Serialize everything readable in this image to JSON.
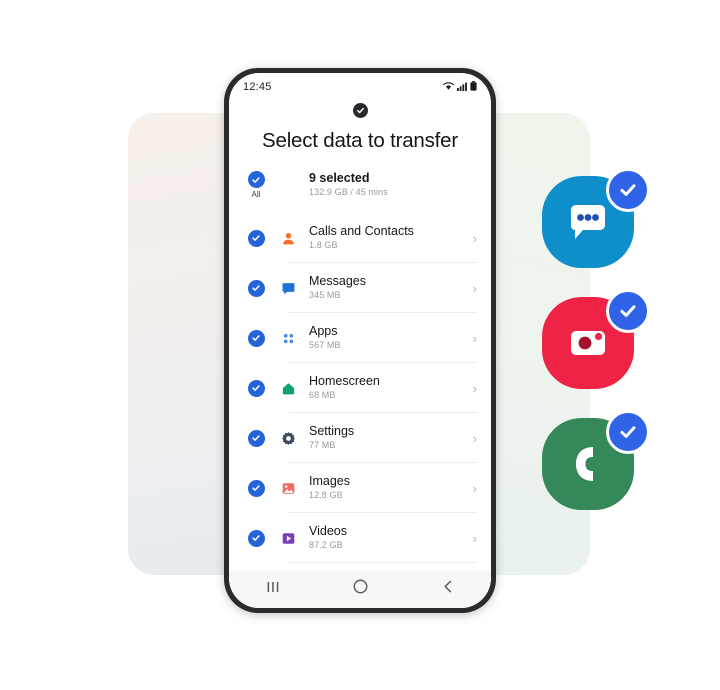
{
  "background": {
    "panel_left_color": "#f3eeec",
    "panel_right_color": "#eef4ee"
  },
  "phone": {
    "status_bar": {
      "time": "12:45",
      "icons": [
        "wifi-icon",
        "signal-icon",
        "battery-icon"
      ]
    },
    "camera_badge_icon": "check-circle-icon",
    "title": "Select data to transfer",
    "summary": {
      "checkbox_label": "All",
      "title": "9 selected",
      "subtitle": "132.9 GB / 45 mins",
      "checked": true
    },
    "items": [
      {
        "icon": "contacts-icon",
        "icon_color": "#f2722b",
        "title": "Calls and Contacts",
        "size": "1.8 GB",
        "checked": true,
        "chevron": "›"
      },
      {
        "icon": "messages-icon",
        "icon_color": "#1f72d6",
        "title": "Messages",
        "size": "345 MB",
        "checked": true,
        "chevron": "›"
      },
      {
        "icon": "apps-grid-icon",
        "icon_color": "#4f8ee0",
        "title": "Apps",
        "size": "567 MB",
        "checked": true,
        "chevron": "›"
      },
      {
        "icon": "homescreen-icon",
        "icon_color": "#12a177",
        "title": "Homescreen",
        "size": "68 MB",
        "checked": true,
        "chevron": "›"
      },
      {
        "icon": "settings-gear-icon",
        "icon_color": "#3d4a5c",
        "title": "Settings",
        "size": "77 MB",
        "checked": true,
        "chevron": "›"
      },
      {
        "icon": "images-icon",
        "icon_color": "#ec6d67",
        "title": "Images",
        "size": "12.8 GB",
        "checked": true,
        "chevron": "›"
      },
      {
        "icon": "videos-icon",
        "icon_color": "#7b3fb5",
        "title": "Videos",
        "size": "87.2 GB",
        "checked": true,
        "chevron": "›"
      }
    ],
    "nav_bar": {
      "recents_icon": "recents-icon",
      "home_icon": "home-circle-icon",
      "back_icon": "back-chevron-icon"
    }
  },
  "floating_icons": [
    {
      "name": "messages-app-icon",
      "color": "#0e8ecb",
      "badge": "check-badge",
      "badge_color": "#2f63e8"
    },
    {
      "name": "gallery-app-icon",
      "color": "#ef2346",
      "badge": "check-badge",
      "badge_color": "#2f63e8"
    },
    {
      "name": "phone-app-icon",
      "color": "#34885a",
      "badge": "check-badge",
      "badge_color": "#2f63e8"
    }
  ],
  "theme": {
    "accent_blue": "#2563d9",
    "badge_blue": "#2f63e8"
  }
}
